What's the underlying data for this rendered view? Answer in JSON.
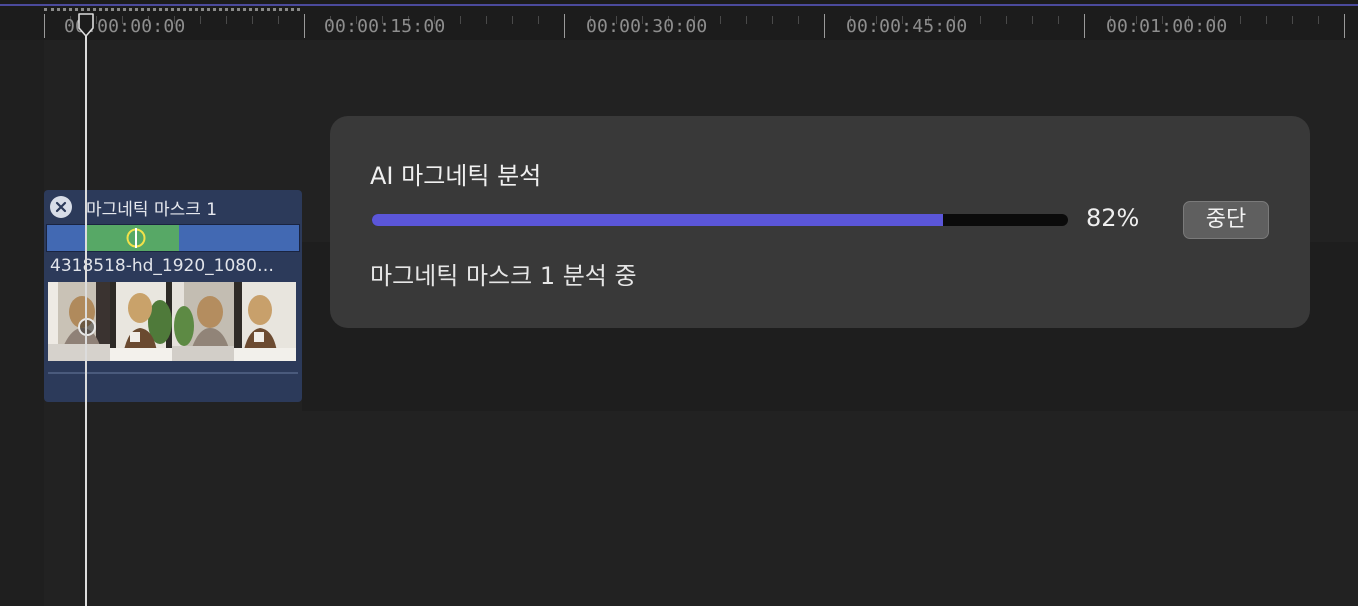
{
  "ruler": {
    "labels": [
      "00:00:00:00",
      "00:00:15:00",
      "00:00:30:00",
      "00:00:45:00",
      "00:01:00:00"
    ]
  },
  "clip": {
    "mask_title": "마그네틱 마스크 1",
    "filename": "4318518-hd_1920_1080…",
    "mask_color": "#57a866",
    "clip_color": "#4269b3"
  },
  "dialog": {
    "title": "AI 마그네틱 분석",
    "progress": 0.82,
    "percent_label": "82%",
    "stop_label": "중단",
    "status": "마그네틱 마스크 1 분석 중",
    "accent_color": "#5b56d9"
  },
  "icons": {
    "close": "close-icon",
    "playhead": "playhead-icon",
    "mask_handle": "mask-handle-icon"
  }
}
